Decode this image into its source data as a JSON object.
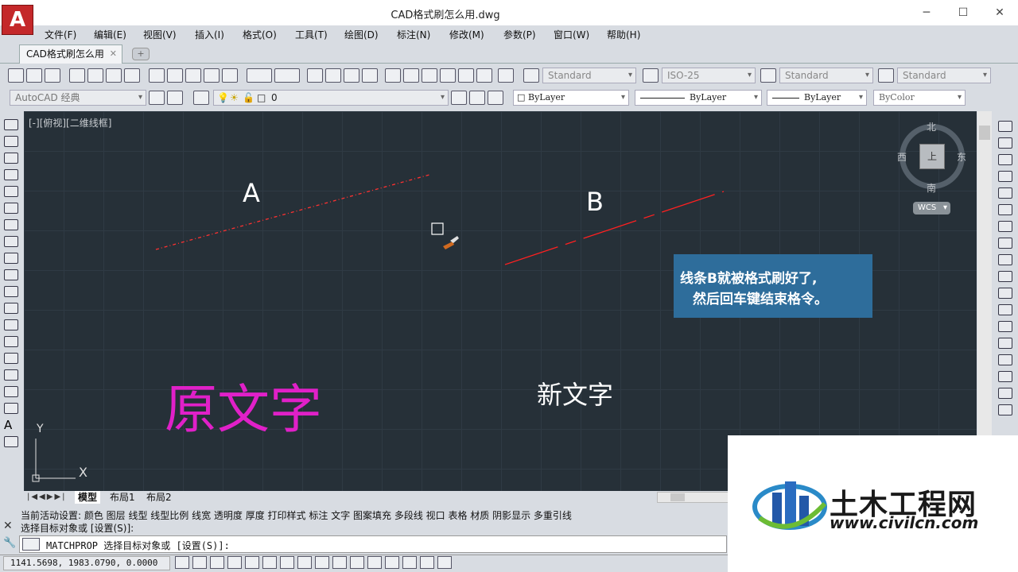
{
  "window": {
    "title": "CAD格式刷怎么用.dwg",
    "logo": "A",
    "minimize": "─",
    "maximize": "☐",
    "close": "✕"
  },
  "menu": [
    "文件(F)",
    "编辑(E)",
    "视图(V)",
    "插入(I)",
    "格式(O)",
    "工具(T)",
    "绘图(D)",
    "标注(N)",
    "修改(M)",
    "参数(P)",
    "窗口(W)",
    "帮助(H)"
  ],
  "tabs": {
    "doc": "CAD格式刷怎么用",
    "close": "✕"
  },
  "toolbar": {
    "text_style": "Standard",
    "dim_style": "ISO-25",
    "table_style": "Standard",
    "mleader_style": "Standard",
    "workspace": "AutoCAD 经典",
    "layer": "0",
    "color": "ByLayer",
    "linetype": "ByLayer",
    "lineweight": "ByLayer",
    "plotstyle": "ByColor"
  },
  "viewport": {
    "label": "[-][俯视][二维线框]"
  },
  "viewcube": {
    "north": "北",
    "south": "南",
    "east": "东",
    "west": "西",
    "top": "上",
    "wcs": "WCS"
  },
  "drawing": {
    "label_a": "A",
    "label_b": "B",
    "old_text": "原文字",
    "new_text": "新文字",
    "ucs_y": "Y",
    "ucs_x": "X"
  },
  "layout_tabs": [
    "模型",
    "布局1",
    "布局2"
  ],
  "command": {
    "history1": "当前活动设置:  颜色 图层 线型 线型比例 线宽 透明度 厚度 打印样式 标注 文字 图案填充 多段线 视口 表格 材质 阴影显示 多重引线",
    "history2": "选择目标对象或 [设置(S)]:",
    "prompt": "MATCHPROP 选择目标对象或 [设置(S)]:"
  },
  "status": {
    "coords": "1141.5698, 1983.0790, 0.0000"
  },
  "callout": {
    "line1": "线条B就被格式刷好了,",
    "line2": "然后回车键结束格令。"
  },
  "watermark": {
    "name": "土木工程网",
    "url": "www.civilcn.com"
  },
  "colors": {
    "canvas": "#263038",
    "dashed_line": "#ff3030",
    "old_text": "#e020c8",
    "callout": "#2e6d9b"
  }
}
